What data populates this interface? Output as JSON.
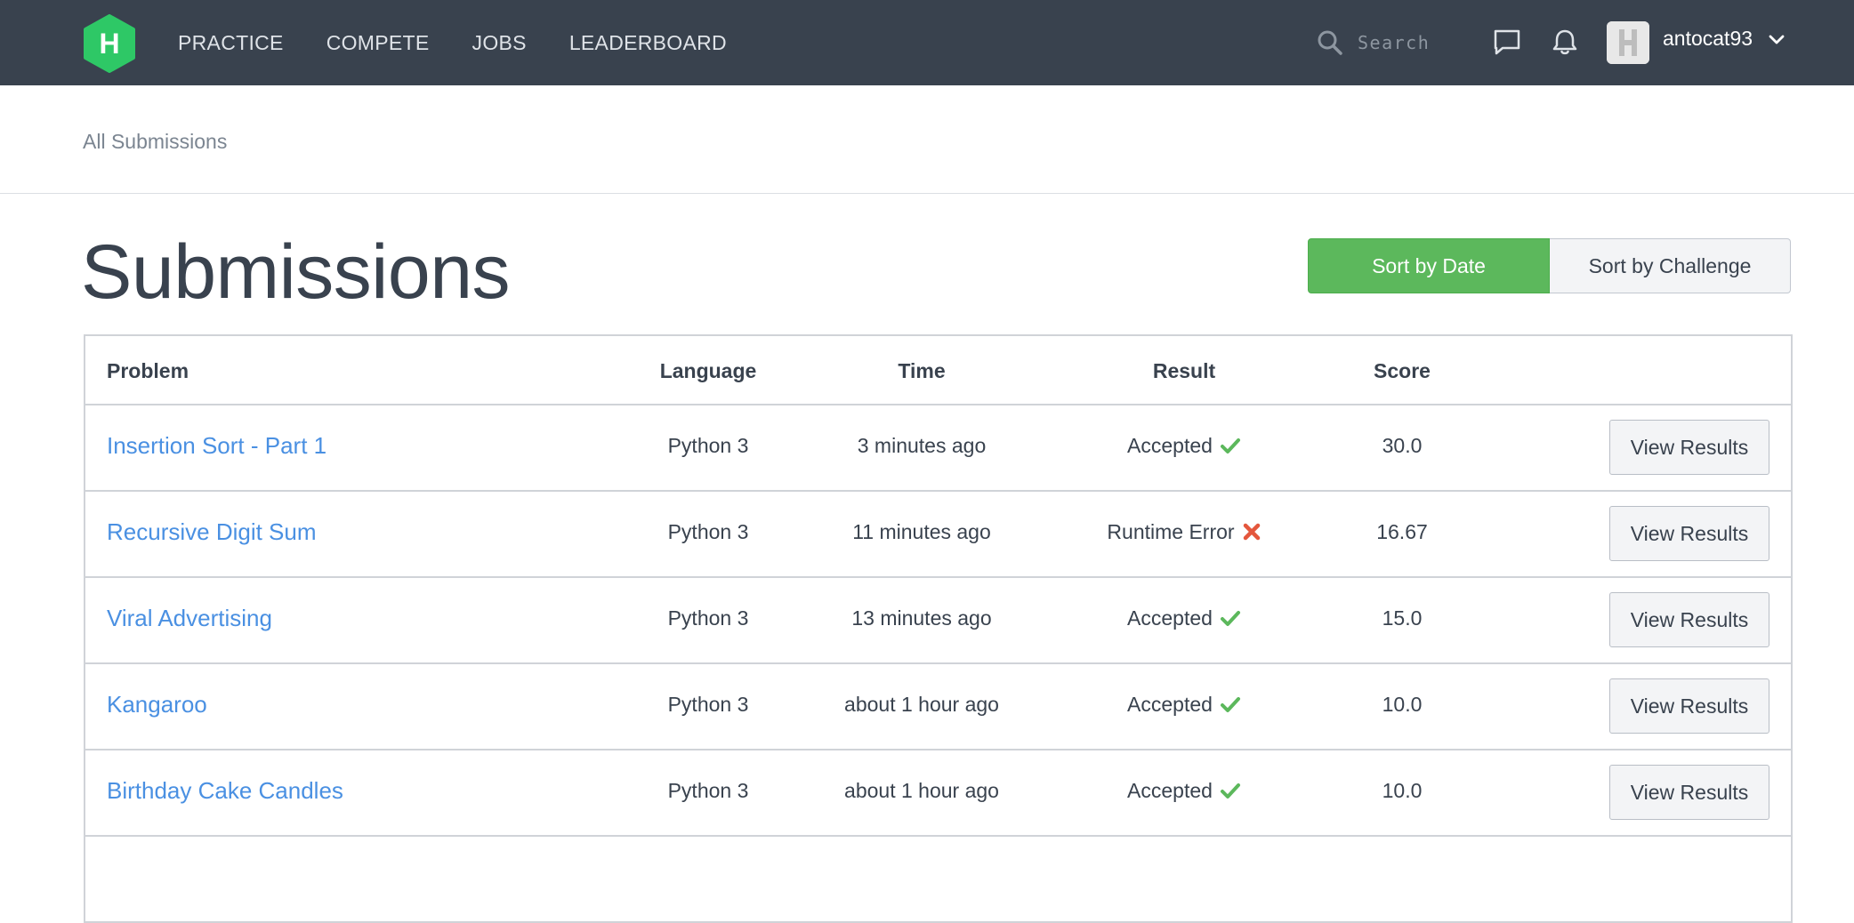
{
  "nav": {
    "logo_letter": "H",
    "links": [
      "PRACTICE",
      "COMPETE",
      "JOBS",
      "LEADERBOARD"
    ],
    "search_placeholder": "Search",
    "username": "antocat93",
    "icons": {
      "search": "search-icon",
      "chat": "chat-icon",
      "notifications": "bell-icon",
      "menu": "chevron-down-icon"
    }
  },
  "breadcrumb": "All Submissions",
  "page_title": "Submissions",
  "sort": {
    "by_date": "Sort by Date",
    "by_challenge": "Sort by Challenge",
    "active": "by_date"
  },
  "table": {
    "headers": {
      "problem": "Problem",
      "language": "Language",
      "time": "Time",
      "result": "Result",
      "score": "Score"
    },
    "view_label": "View Results",
    "rows": [
      {
        "problem": "Insertion Sort - Part 1",
        "language": "Python 3",
        "time": "3 minutes ago",
        "result": "Accepted",
        "status": "accepted",
        "score": "30.0"
      },
      {
        "problem": "Recursive Digit Sum",
        "language": "Python 3",
        "time": "11 minutes ago",
        "result": "Runtime Error",
        "status": "error",
        "score": "16.67"
      },
      {
        "problem": "Viral Advertising",
        "language": "Python 3",
        "time": "13 minutes ago",
        "result": "Accepted",
        "status": "accepted",
        "score": "15.0"
      },
      {
        "problem": "Kangaroo",
        "language": "Python 3",
        "time": "about 1 hour ago",
        "result": "Accepted",
        "status": "accepted",
        "score": "10.0"
      },
      {
        "problem": "Birthday Cake Candles",
        "language": "Python 3",
        "time": "about 1 hour ago",
        "result": "Accepted",
        "status": "accepted",
        "score": "10.0"
      }
    ]
  },
  "colors": {
    "nav_bg": "#39424e",
    "brand_green": "#2ec866",
    "accent_green": "#5cb85c",
    "link_blue": "#4a90e2",
    "error_red": "#e4573d"
  }
}
